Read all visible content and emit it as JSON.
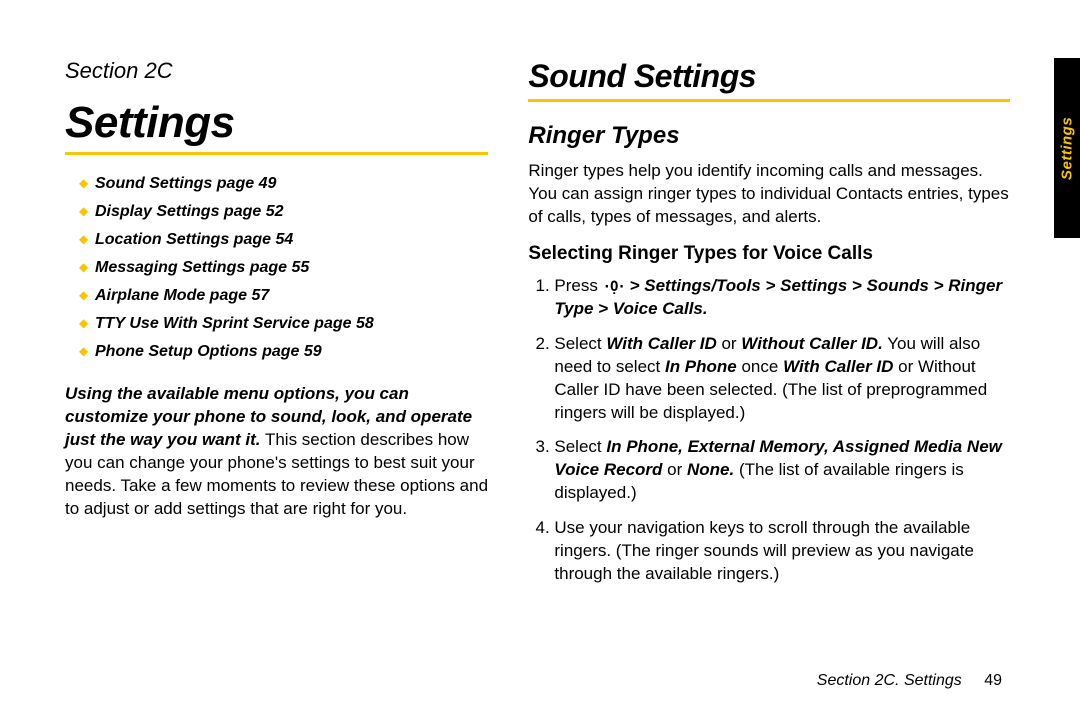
{
  "left": {
    "section_label": "Section 2C",
    "title": "Settings",
    "toc": [
      "Sound Settings page 49",
      "Display Settings page 52",
      "Location Settings page 54",
      "Messaging Settings page 55",
      "Airplane Mode page 57",
      "TTY Use With Sprint Service page 58",
      "Phone Setup Options page 59"
    ],
    "intro_lead": "Using the available menu options, you can customize your phone to sound, look, and operate just the way you want it.",
    "intro_rest": " This section describes how you can change your phone's settings to best suit your needs. Take a few moments to review these options and to adjust or add settings that are right for you."
  },
  "right": {
    "title": "Sound Settings",
    "subtitle": "Ringer Types",
    "para1": "Ringer types help you identify incoming calls and messages. You can assign ringer types to individual Contacts entries, types of calls, types of messages, and alerts.",
    "subhead": "Selecting Ringer Types for Voice Calls",
    "steps": {
      "s1_prefix": "Press ",
      "s1_path": "> Settings/Tools > Settings > Sounds > Ringer Type > Voice Calls.",
      "s2_a": "Select ",
      "s2_b1": "With Caller ID",
      "s2_mid": " or ",
      "s2_b2": "Without Caller ID.",
      "s2_c": " You will also need to select ",
      "s2_d": "In Phone",
      "s2_e": " once ",
      "s2_f": "With Caller ID",
      "s2_g": " or Without Caller ID have been selected. (The list of preprogrammed ringers will be displayed.)",
      "s3_a": "Select ",
      "s3_b": "In Phone, External Memory, Assigned Media New Voice Record",
      "s3_c": " or ",
      "s3_d": "None.",
      "s3_e": " (The list of available ringers is displayed.)",
      "s4": "Use your navigation keys to scroll through the available ringers. (The ringer sounds will preview as you navigate through the available ringers.)"
    }
  },
  "footer": {
    "label": "Section 2C. Settings",
    "page": "49"
  },
  "sidetab": "Settings"
}
